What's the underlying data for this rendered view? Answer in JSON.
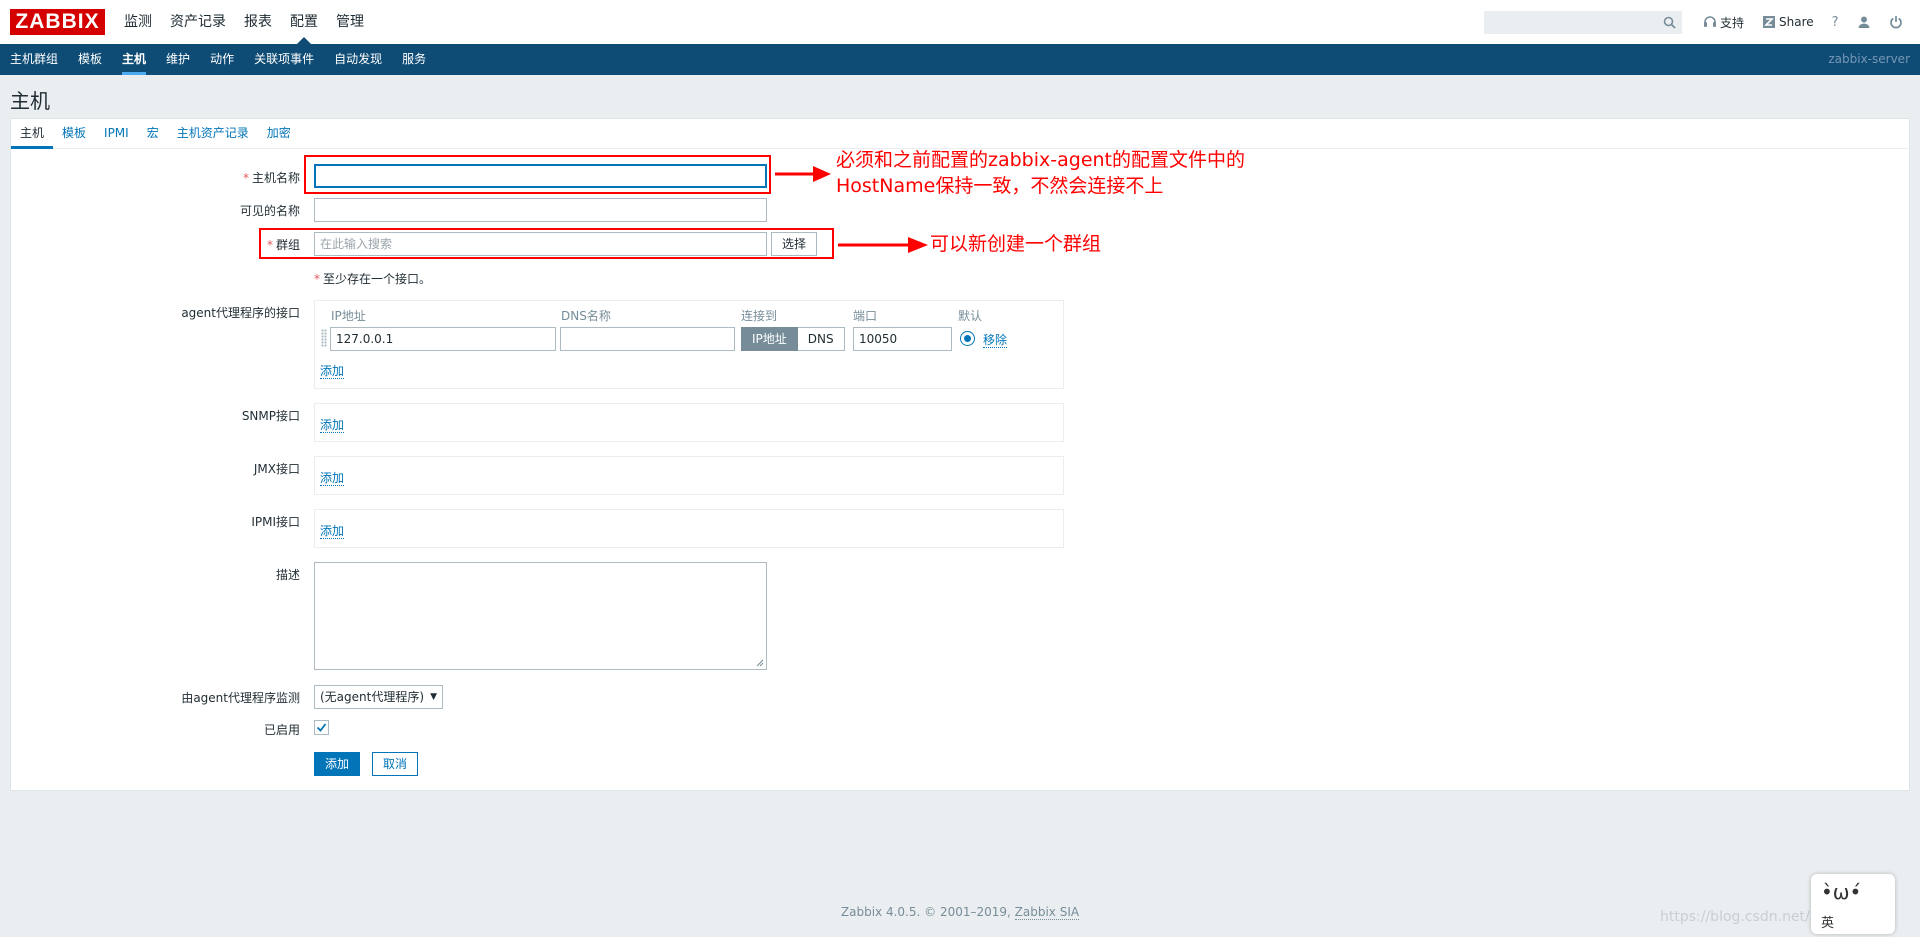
{
  "header": {
    "logo": "ZABBIX",
    "nav": [
      "监测",
      "资产记录",
      "报表",
      "配置",
      "管理"
    ],
    "active_nav": "配置",
    "search_placeholder": "",
    "support": "支持",
    "share": "Share",
    "help": "?"
  },
  "subnav": {
    "items": [
      "主机群组",
      "模板",
      "主机",
      "维护",
      "动作",
      "关联项事件",
      "自动发现",
      "服务"
    ],
    "active": "主机",
    "server": "zabbix-server"
  },
  "page_title": "主机",
  "tabs": [
    "主机",
    "模板",
    "IPMI",
    "宏",
    "主机资产记录",
    "加密"
  ],
  "form": {
    "host_name_label": "主机名称",
    "visible_name_label": "可见的名称",
    "groups_label": "群组",
    "groups_placeholder": "在此输入搜索",
    "select_button": "选择",
    "interface_note": "至少存在一个接口。",
    "agent_label": "agent代理程序的接口",
    "iface_headers": {
      "ip": "IP地址",
      "dns": "DNS名称",
      "connect": "连接到",
      "port": "端口",
      "default": "默认"
    },
    "agent_ip": "127.0.0.1",
    "agent_dns": "",
    "connect_ip": "IP地址",
    "connect_dns": "DNS",
    "agent_port": "10050",
    "remove": "移除",
    "add": "添加",
    "snmp_label": "SNMP接口",
    "jmx_label": "JMX接口",
    "ipmi_label": "IPMI接口",
    "description_label": "描述",
    "proxy_label": "由agent代理程序监测",
    "proxy_value": "(无agent代理程序)",
    "enabled_label": "已启用",
    "submit": "添加",
    "cancel": "取消"
  },
  "annotations": {
    "note1_line1": "必须和之前配置的zabbix-agent的配置文件中的",
    "note1_line2": "HostName保持一致，不然会连接不上",
    "note2": "可以新创建一个群组",
    "color": "#ff0000"
  },
  "footer": {
    "text": "Zabbix 4.0.5. © 2001–2019, ",
    "link": "Zabbix SIA",
    "watermark": "https://blog.csdn.net/Sebastians"
  },
  "mascot": {
    "face": "•̀ω•́",
    "label": "英"
  },
  "colors": {
    "brand_red": "#d40000",
    "subnav": "#0f4c75",
    "link": "#0275b8"
  }
}
